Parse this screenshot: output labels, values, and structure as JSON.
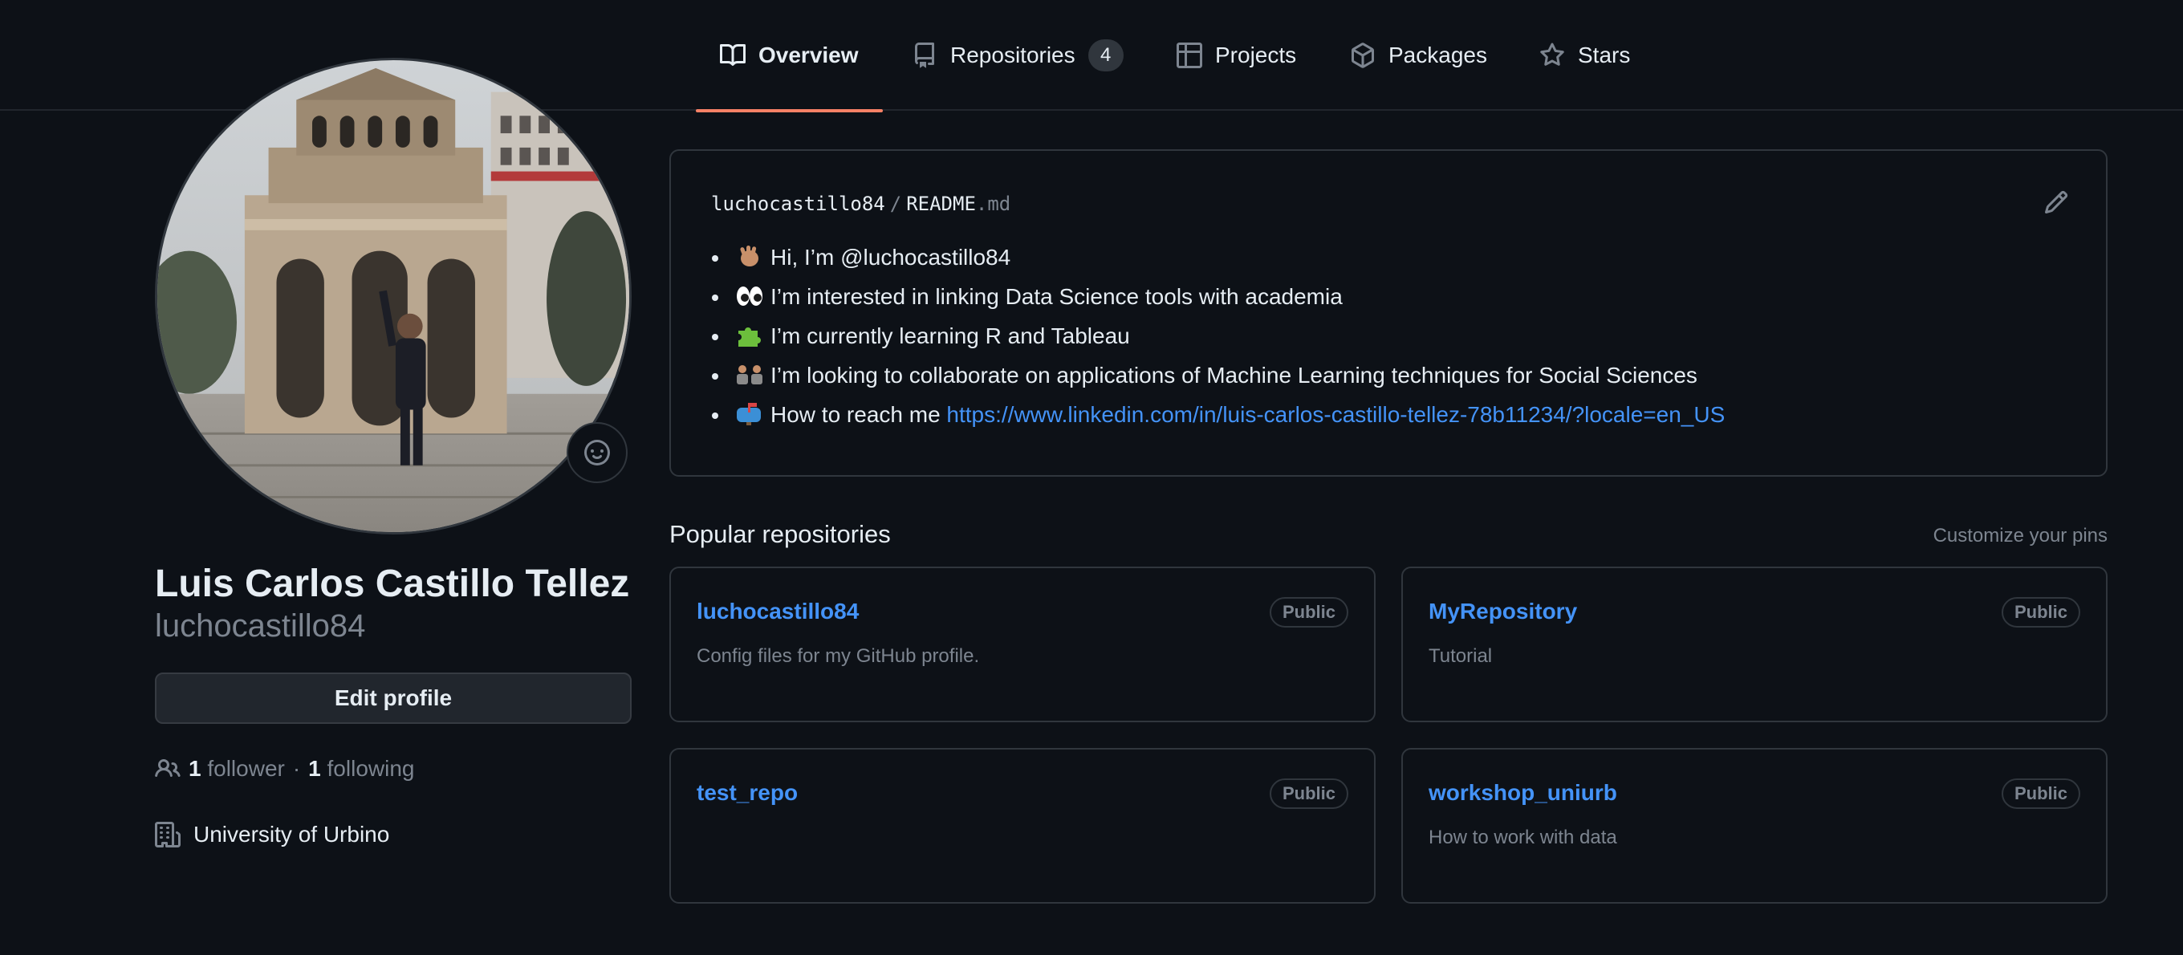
{
  "nav": {
    "tabs": [
      {
        "label": "Overview",
        "icon": "book-icon",
        "active": true
      },
      {
        "label": "Repositories",
        "icon": "repo-icon",
        "count": "4"
      },
      {
        "label": "Projects",
        "icon": "table-icon"
      },
      {
        "label": "Packages",
        "icon": "package-icon"
      },
      {
        "label": "Stars",
        "icon": "star-icon"
      }
    ]
  },
  "profile": {
    "name": "Luis Carlos Castillo Tellez",
    "login": "luchocastillo84",
    "edit_label": "Edit profile",
    "followers_count": "1",
    "followers_label": "follower",
    "separator": "·",
    "following_count": "1",
    "following_label": "following",
    "organization": "University of Urbino"
  },
  "readme": {
    "owner": "luchocastillo84",
    "separator": "/",
    "file": "README",
    "ext": ".md",
    "items": [
      {
        "emoji": "wave",
        "text": "Hi, I’m @luchocastillo84"
      },
      {
        "emoji": "eyes",
        "text": "I’m interested in linking Data Science tools with academia"
      },
      {
        "emoji": "seedling",
        "text": "I’m currently learning R and Tableau"
      },
      {
        "emoji": "people",
        "text": "I’m looking to collaborate on applications of Machine Learning techniques for Social Sciences"
      },
      {
        "emoji": "mailbox",
        "text": "How to reach me ",
        "link": "https://www.linkedin.com/in/luis-carlos-castillo-tellez-78b11234/?locale=en_US"
      }
    ]
  },
  "popular": {
    "title": "Popular repositories",
    "customize": "Customize your pins",
    "repos": [
      {
        "name": "luchocastillo84",
        "visibility": "Public",
        "description": "Config files for my GitHub profile."
      },
      {
        "name": "MyRepository",
        "visibility": "Public",
        "description": "Tutorial"
      },
      {
        "name": "test_repo",
        "visibility": "Public",
        "description": ""
      },
      {
        "name": "workshop_uniurb",
        "visibility": "Public",
        "description": "How to work with data"
      }
    ]
  },
  "colors": {
    "background": "#0d1117",
    "border": "#30363d",
    "link": "#4493f8",
    "active_underline": "#f78166",
    "muted": "#7d8590"
  }
}
